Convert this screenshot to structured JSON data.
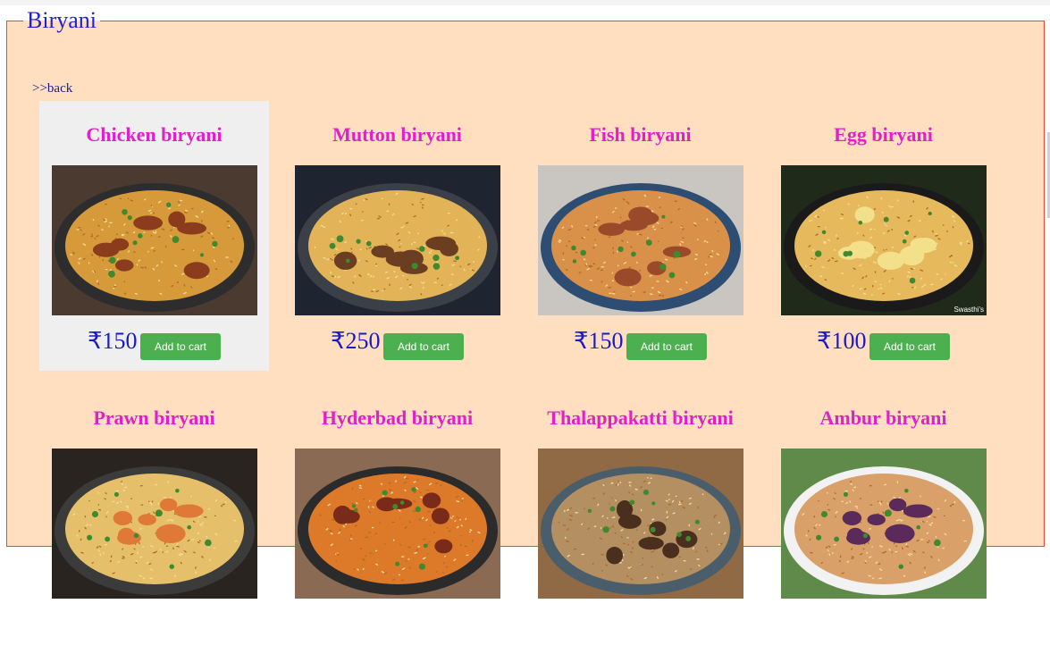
{
  "section": {
    "legend": "Biryani",
    "back_link": ">>back"
  },
  "cart_button_label": "Add to cart",
  "items": [
    {
      "name": "Chicken biryani",
      "price": "₹150",
      "image_icon": "chicken-biryani-photo",
      "colors": {
        "rice": "#d79a3a",
        "accent": "#8a3c1c",
        "dish": "#2d2d2d",
        "bg": "#4a3a30"
      }
    },
    {
      "name": "Mutton biryani",
      "price": "₹250",
      "image_icon": "mutton-biryani-photo",
      "colors": {
        "rice": "#e2b357",
        "accent": "#6b3e22",
        "dish": "#3a3f48",
        "bg": "#1e2430"
      }
    },
    {
      "name": "Fish biryani",
      "price": "₹150",
      "image_icon": "fish-biryani-photo",
      "colors": {
        "rice": "#d9914a",
        "accent": "#9a4a2a",
        "dish": "#2e4d73",
        "bg": "#c9c6c2"
      }
    },
    {
      "name": "Egg biryani",
      "price": "₹100",
      "image_icon": "egg-biryani-photo",
      "colors": {
        "rice": "#e5b95c",
        "accent": "#f2e08a",
        "dish": "#1a1a1a",
        "bg": "#1f2a1a"
      },
      "watermark": "Swasthi's"
    },
    {
      "name": "Prawn biryani",
      "image_icon": "prawn-biryani-photo",
      "colors": {
        "rice": "#e6bf6a",
        "accent": "#e07838",
        "dish": "#3b3b3b",
        "bg": "#2a2420"
      }
    },
    {
      "name": "Hyderbad biryani",
      "image_icon": "hyderabad-biryani-photo",
      "colors": {
        "rice": "#dd7a2a",
        "accent": "#7a2a18",
        "dish": "#2b2b2b",
        "bg": "#8a6a52"
      }
    },
    {
      "name": "Thalappakatti biryani",
      "image_icon": "thalappakatti-biryani-photo",
      "colors": {
        "rice": "#b38f62",
        "accent": "#4a2f1e",
        "dish": "#4a5d6a",
        "bg": "#8f6a45"
      }
    },
    {
      "name": "Ambur biryani",
      "image_icon": "ambur-biryani-photo",
      "colors": {
        "rice": "#d9a06a",
        "accent": "#5a2a5a",
        "dish": "#f2f2f2",
        "bg": "#5f8a4a"
      }
    }
  ],
  "colors": {
    "panel_bg": "#ffdfc0",
    "border": "#e8463c",
    "title": "#e020c8",
    "price": "#1a1ac8",
    "button": "#4caf50"
  }
}
